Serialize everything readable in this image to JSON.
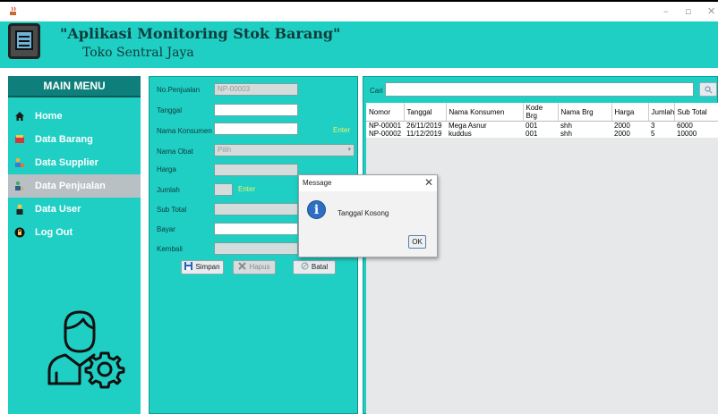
{
  "window": {
    "minimize_glyph": "–",
    "restore_glyph": "▫",
    "close_glyph": "✕"
  },
  "header": {
    "title": "\"Aplikasi Monitoring Stok Barang\"",
    "subtitle": "Toko Sentral Jaya"
  },
  "sidebar": {
    "title": "MAIN MENU",
    "items": [
      {
        "label": "Home",
        "icon": "home-icon"
      },
      {
        "label": "Data Barang",
        "icon": "box-icon"
      },
      {
        "label": "Data Supplier",
        "icon": "supplier-icon"
      },
      {
        "label": "Data Penjualan",
        "icon": "sales-icon",
        "active": true
      },
      {
        "label": "Data User",
        "icon": "user-icon"
      },
      {
        "label": "Log Out",
        "icon": "logout-icon"
      }
    ]
  },
  "form": {
    "no_penjualan_label": "No.Penjualan",
    "no_penjualan_value": "NP-00003",
    "tanggal_label": "Tanggal",
    "nama_konsumen_label": "Nama Konsumen",
    "enter_hint": "Enter",
    "nama_obat_label": "Nama Obat",
    "nama_obat_value": "Pilih",
    "harga_label": "Harga",
    "jumlah_label": "Jumlah",
    "sub_total_label": "Sub Total",
    "bayar_label": "Bayar",
    "kembali_label": "Kembali",
    "simpan_label": "Simpan",
    "hapus_label": "Hapus",
    "batal_label": "Batal"
  },
  "search": {
    "label": "Cari"
  },
  "table": {
    "headers": [
      "Nomor",
      "Tanggal",
      "Nama Konsumen",
      "Kode Brg",
      "Nama Brg",
      "Harga",
      "Jumlah",
      "Sub Total"
    ],
    "rows": [
      [
        "NP-00001",
        "26/11/2019",
        "Mega Asnur",
        "001",
        "shh",
        "2000",
        "3",
        "6000"
      ],
      [
        "NP-00002",
        "11/12/2019",
        "kuddus",
        "001",
        "shh",
        "2000",
        "5",
        "10000"
      ]
    ]
  },
  "dialog": {
    "title": "Message",
    "message": "Tanggal Kosong",
    "ok_label": "OK",
    "info_glyph": "i"
  },
  "colors": {
    "accent": "#1fcfc4",
    "menu_header": "#0e7f7a",
    "active_item": "#b8c0c4"
  }
}
